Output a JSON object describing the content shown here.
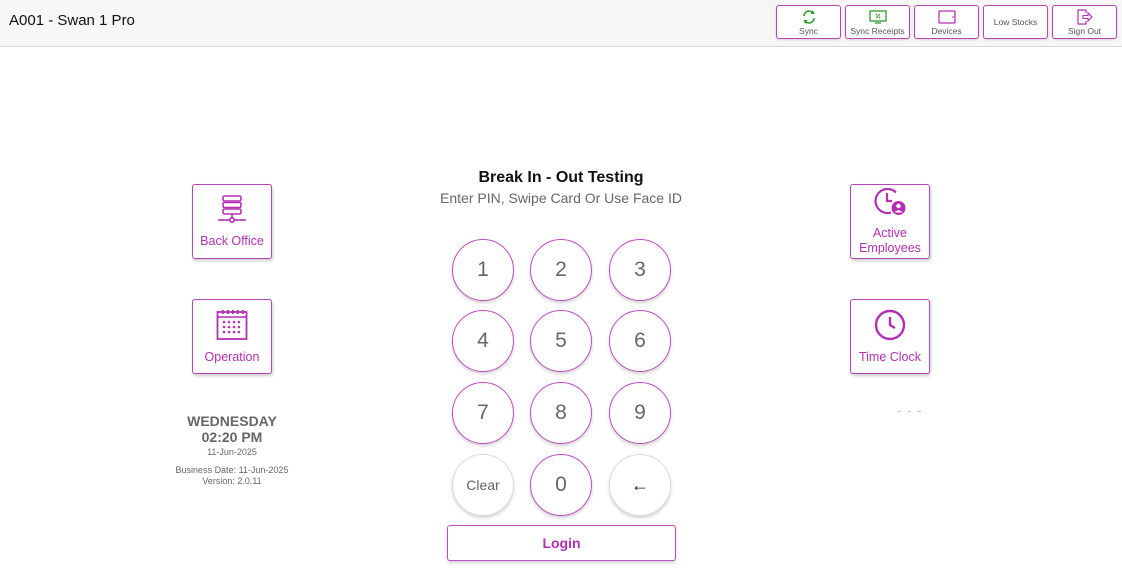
{
  "header": {
    "title": "A001 - Swan 1 Pro",
    "buttons": {
      "sync": "Sync",
      "sync_receipts": "Sync Receipts",
      "devices": "Devices",
      "low_stocks": "Low Stocks",
      "sign_out": "Sign Out"
    }
  },
  "left_tiles": {
    "back_office": "Back Office",
    "operation": "Operation"
  },
  "right_tiles": {
    "active_employees": "Active Employees",
    "time_clock": "Time Clock"
  },
  "main": {
    "title": "Break In - Out Testing",
    "subtitle": "Enter PIN, Swipe Card Or Use Face ID"
  },
  "keypad": {
    "k1": "1",
    "k2": "2",
    "k3": "3",
    "k4": "4",
    "k5": "5",
    "k6": "6",
    "k7": "7",
    "k8": "8",
    "k9": "9",
    "clear": "Clear",
    "k0": "0",
    "backspace": "←"
  },
  "login_label": "Login",
  "datetime": {
    "day": "WEDNESDAY",
    "time": "02:20 PM",
    "date": "11-Jun-2025",
    "business_date": "Business Date: 11-Jun-2025",
    "version": "Version: 2.0.11"
  },
  "colors": {
    "accent": "#b32fb3",
    "sync_green": "#2e9a2e"
  }
}
